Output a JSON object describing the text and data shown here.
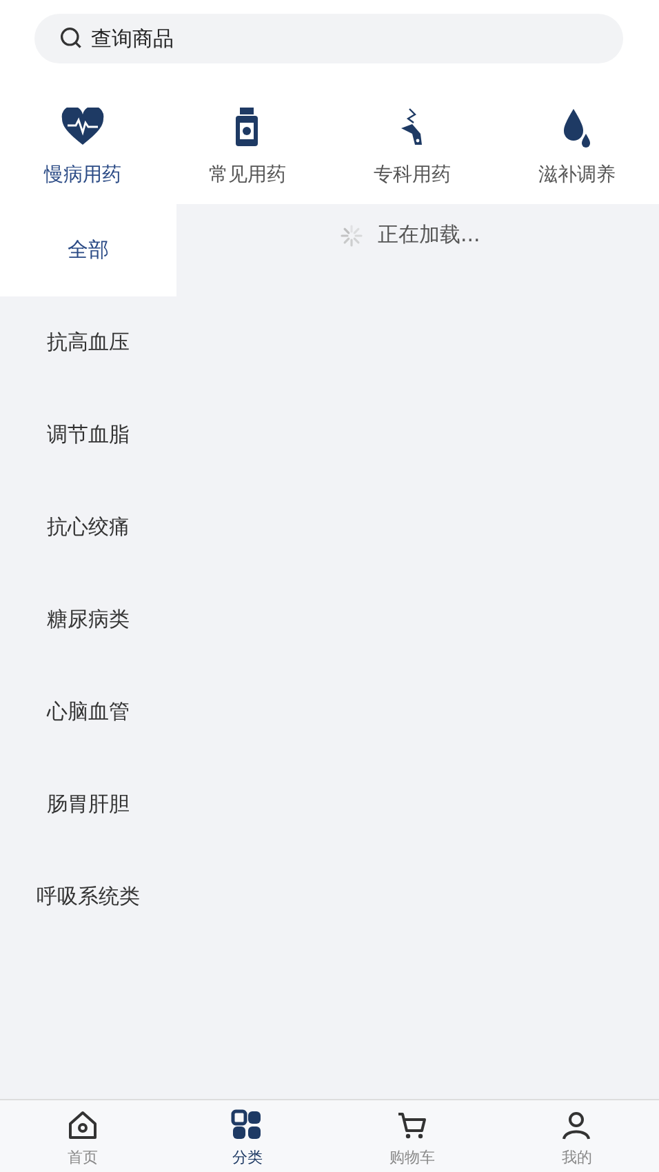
{
  "search": {
    "placeholder": "查询商品"
  },
  "categories": [
    {
      "label": "慢病用药",
      "kind": "heart",
      "selected": true
    },
    {
      "label": "常见用药",
      "kind": "bottle",
      "selected": false
    },
    {
      "label": "专科用药",
      "kind": "tool",
      "selected": false
    },
    {
      "label": "滋补调养",
      "kind": "drops",
      "selected": false
    }
  ],
  "sidebar": {
    "items": [
      {
        "label": "全部",
        "selected": true
      },
      {
        "label": "抗高血压",
        "selected": false
      },
      {
        "label": "调节血脂",
        "selected": false
      },
      {
        "label": "抗心绞痛",
        "selected": false
      },
      {
        "label": "糖尿病类",
        "selected": false
      },
      {
        "label": "心脑血管",
        "selected": false
      },
      {
        "label": "肠胃肝胆",
        "selected": false
      },
      {
        "label": "呼吸系统类",
        "selected": false
      }
    ]
  },
  "content": {
    "loading_text": "正在加载..."
  },
  "tab_bar": [
    {
      "label": "首页",
      "kind": "home",
      "selected": false
    },
    {
      "label": "分类",
      "kind": "grid",
      "selected": true
    },
    {
      "label": "购物车",
      "kind": "cart",
      "selected": false
    },
    {
      "label": "我的",
      "kind": "person",
      "selected": false
    }
  ]
}
